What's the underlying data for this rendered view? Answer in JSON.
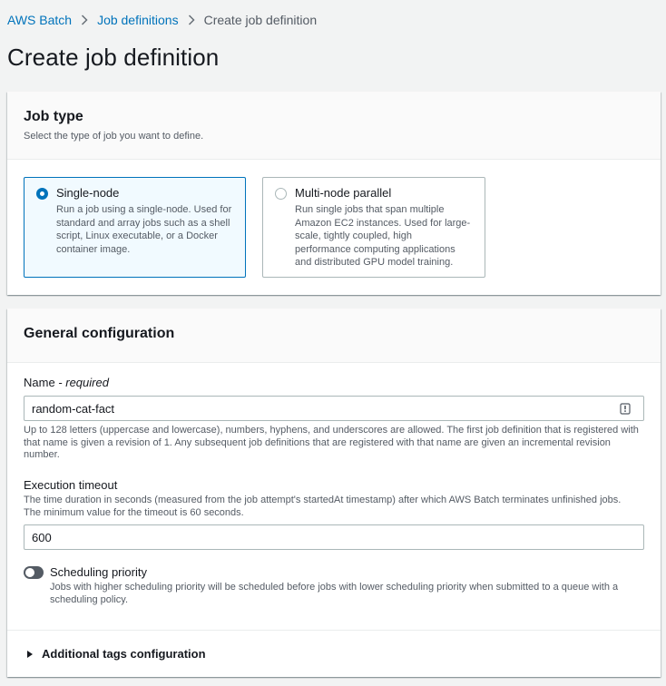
{
  "breadcrumb": {
    "items": [
      "AWS Batch",
      "Job definitions"
    ],
    "current": "Create job definition"
  },
  "page_title": "Create job definition",
  "job_type": {
    "title": "Job type",
    "description": "Select the type of job you want to define.",
    "options": [
      {
        "label": "Single-node",
        "desc_lines": [
          "Run a job using a single-node. Used for",
          "standard and array jobs such as a shell",
          "script, Linux executable, or a Docker",
          "container image."
        ],
        "selected": true
      },
      {
        "label": "Multi-node parallel",
        "desc_lines": [
          "Run single jobs that span multiple",
          "Amazon EC2 instances. Used for large-",
          "scale, tightly coupled, high",
          "performance computing applications",
          "and distributed GPU model training."
        ],
        "selected": false
      }
    ]
  },
  "general": {
    "title": "General configuration",
    "name": {
      "label": "Name",
      "required_text": " - required",
      "value": "random-cat-fact",
      "hint_lines": [
        "Up to 128 letters (uppercase and lowercase), numbers, hyphens, and underscores are allowed. The first job definition that is registered with",
        "that name is given a revision of 1. Any subsequent job definitions that are registered with that name are given an incremental revision",
        "number."
      ]
    },
    "timeout": {
      "label": "Execution timeout",
      "hint_lines": [
        "The time duration in seconds (measured from the job attempt's startedAt timestamp) after which AWS Batch terminates unfinished jobs.",
        "The minimum value for the timeout is 60 seconds."
      ],
      "value": "600"
    },
    "scheduling": {
      "label": "Scheduling priority",
      "enabled": false,
      "desc_lines": [
        "Jobs with higher scheduling priority will be scheduled before jobs with lower scheduling priority when submitted to a queue with a",
        "scheduling policy."
      ]
    },
    "tags_label": "Additional tags configuration"
  },
  "colors": {
    "link": "#0073bb",
    "selected_border": "#0073bb",
    "selected_bg": "#f1faff",
    "toggle_off": "#545b64"
  }
}
